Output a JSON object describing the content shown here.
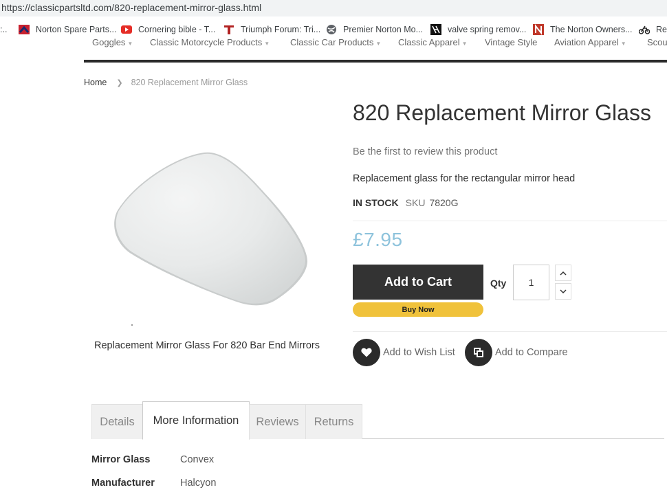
{
  "browser": {
    "url": "https://classicpartsltd.com/820-replacement-mirror-glass.html",
    "bookmarks": [
      {
        "label": "Norton Spare Parts...",
        "icon": "norton-flag-icon"
      },
      {
        "label": "Cornering bible - T...",
        "icon": "youtube-icon"
      },
      {
        "label": "Triumph Forum: Tri...",
        "icon": "triumph-t-icon"
      },
      {
        "label": "Premier Norton Mo...",
        "icon": "globe-icon"
      },
      {
        "label": "valve spring remov...",
        "icon": "tool-icon"
      },
      {
        "label": "The Norton Owners...",
        "icon": "norton-owners-icon"
      },
      {
        "label": "Reb",
        "icon": "motorcycle-icon"
      }
    ]
  },
  "nav": {
    "items": [
      "Goggles",
      "Classic Motorcycle Products",
      "Classic Car Products",
      "Classic Apparel",
      "Vintage Style",
      "Aviation Apparel",
      "Scou"
    ]
  },
  "breadcrumb": {
    "home": "Home",
    "current": "820 Replacement Mirror Glass"
  },
  "product": {
    "title": "820 Replacement Mirror Glass",
    "review_link": "Be the first to review this product",
    "description": "Replacement glass for the rectangular mirror head",
    "stock": "IN STOCK",
    "sku_label": "SKU",
    "sku": "7820G",
    "price": "£7.95",
    "image_caption": "Replacement Mirror Glass For 820 Bar End Mirrors",
    "accent_color": "#8ec3dc"
  },
  "cart": {
    "add_to_cart": "Add to Cart",
    "buy_now": "Buy Now",
    "qty_label": "Qty",
    "qty_value": "1",
    "wishlist": "Add to Wish List",
    "compare": "Add to Compare",
    "buy_now_color": "#f0c23b"
  },
  "tabs": {
    "details": "Details",
    "more_info": "More Information",
    "reviews": "Reviews",
    "returns": "Returns",
    "active": "More Information"
  },
  "more_information": {
    "rows": [
      {
        "label": "Mirror Glass",
        "value": "Convex"
      },
      {
        "label": "Manufacturer",
        "value": "Halcyon"
      }
    ]
  }
}
